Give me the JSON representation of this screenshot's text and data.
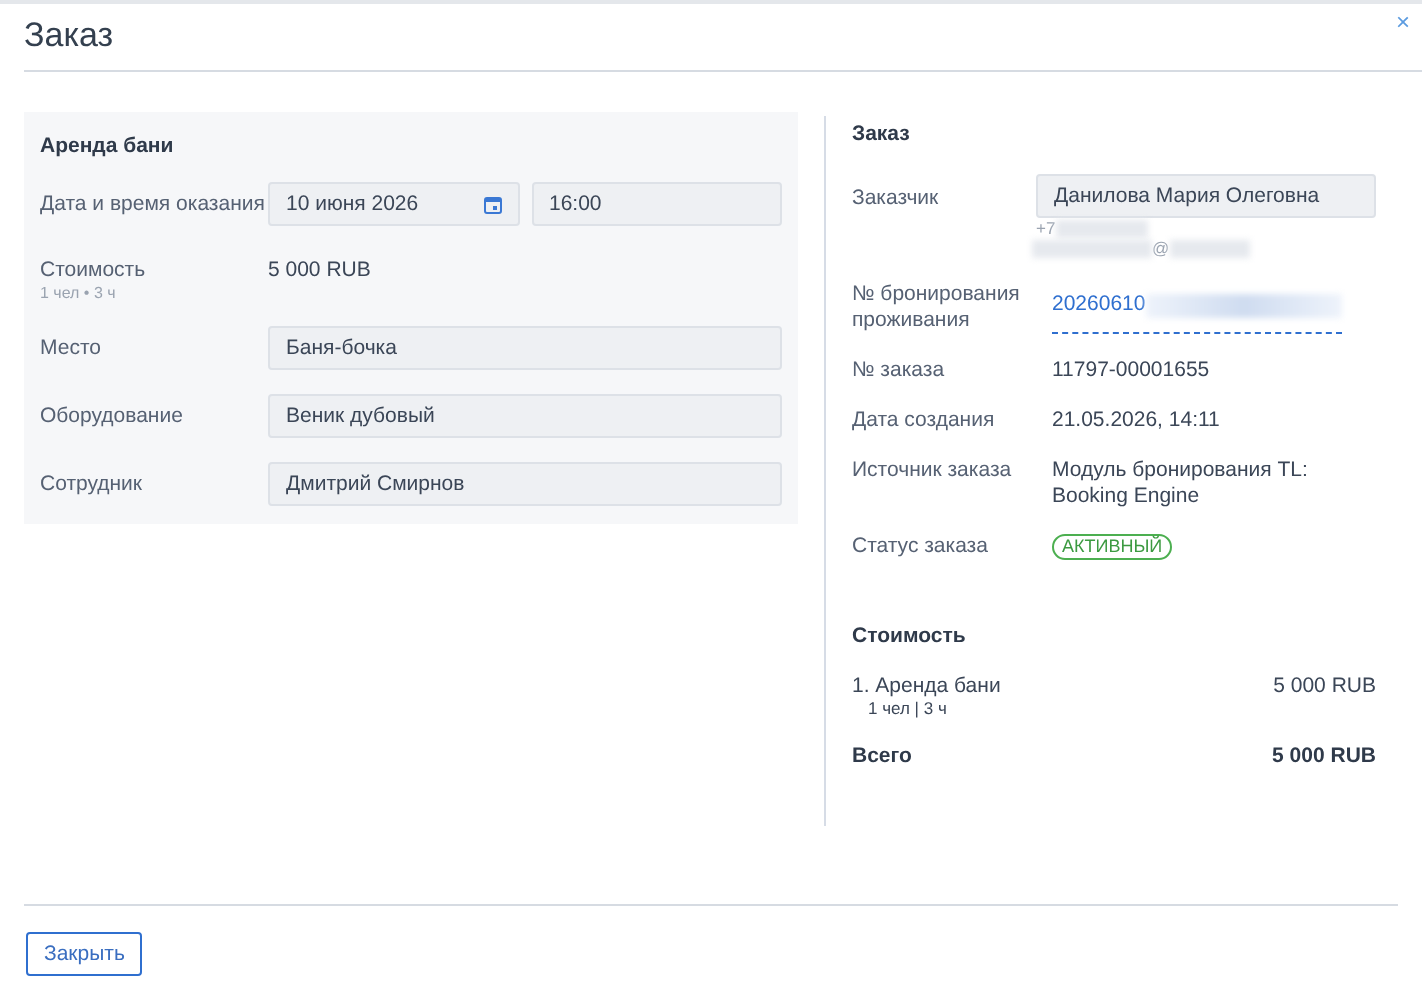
{
  "dialog": {
    "title": "Заказ",
    "close": "×"
  },
  "service": {
    "title": "Аренда бани",
    "rows": [
      {
        "kind": "datetime",
        "label": "Дата и время оказания",
        "date": "10 июня 2026",
        "time": "16:00"
      },
      {
        "kind": "price",
        "label": "Стоимость",
        "note": "1 чел • 3 ч",
        "value": "5 000 RUB"
      },
      {
        "kind": "field",
        "label": "Место",
        "value": "Баня-бочка"
      },
      {
        "kind": "field",
        "label": "Оборудование",
        "value": "Веник дубовый"
      },
      {
        "kind": "field",
        "label": "Сотрудник",
        "value": "Дмитрий Смирнов"
      }
    ]
  },
  "order": {
    "title": "Заказ",
    "rows": [
      {
        "kind": "customer",
        "label": "Заказчик",
        "value": "Данилова Мария Олеговна",
        "phone": "+7",
        "email": "@"
      },
      {
        "kind": "link",
        "label": "№ бронирования проживания",
        "value": "20260610"
      },
      {
        "kind": "text",
        "label": "№ заказа",
        "value": "11797-00001655"
      },
      {
        "kind": "text",
        "label": "Дата создания",
        "value": "21.05.2026, 14:11"
      },
      {
        "kind": "text",
        "label": "Источник заказа",
        "value": "Модуль бронирования TL: Booking Engine"
      },
      {
        "kind": "status",
        "label": "Статус заказа",
        "value": "АКТИВНЫЙ"
      }
    ]
  },
  "cost": {
    "title": "Стоимость",
    "items": [
      {
        "name": "1. Аренда бани",
        "note": "1 чел | 3 ч",
        "price": "5 000 RUB"
      }
    ],
    "total": {
      "label": "Всего",
      "value": "5 000 RUB"
    }
  },
  "buttons": [
    "Закрыть"
  ]
}
